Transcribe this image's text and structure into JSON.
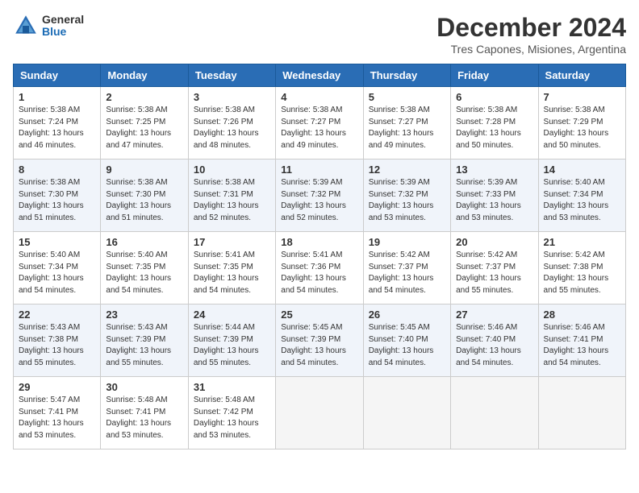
{
  "header": {
    "logo_general": "General",
    "logo_blue": "Blue",
    "month_title": "December 2024",
    "subtitle": "Tres Capones, Misiones, Argentina"
  },
  "columns": [
    "Sunday",
    "Monday",
    "Tuesday",
    "Wednesday",
    "Thursday",
    "Friday",
    "Saturday"
  ],
  "weeks": [
    {
      "shaded": false,
      "days": [
        {
          "num": "1",
          "info": "Sunrise: 5:38 AM\nSunset: 7:24 PM\nDaylight: 13 hours\nand 46 minutes."
        },
        {
          "num": "2",
          "info": "Sunrise: 5:38 AM\nSunset: 7:25 PM\nDaylight: 13 hours\nand 47 minutes."
        },
        {
          "num": "3",
          "info": "Sunrise: 5:38 AM\nSunset: 7:26 PM\nDaylight: 13 hours\nand 48 minutes."
        },
        {
          "num": "4",
          "info": "Sunrise: 5:38 AM\nSunset: 7:27 PM\nDaylight: 13 hours\nand 49 minutes."
        },
        {
          "num": "5",
          "info": "Sunrise: 5:38 AM\nSunset: 7:27 PM\nDaylight: 13 hours\nand 49 minutes."
        },
        {
          "num": "6",
          "info": "Sunrise: 5:38 AM\nSunset: 7:28 PM\nDaylight: 13 hours\nand 50 minutes."
        },
        {
          "num": "7",
          "info": "Sunrise: 5:38 AM\nSunset: 7:29 PM\nDaylight: 13 hours\nand 50 minutes."
        }
      ]
    },
    {
      "shaded": true,
      "days": [
        {
          "num": "8",
          "info": "Sunrise: 5:38 AM\nSunset: 7:30 PM\nDaylight: 13 hours\nand 51 minutes."
        },
        {
          "num": "9",
          "info": "Sunrise: 5:38 AM\nSunset: 7:30 PM\nDaylight: 13 hours\nand 51 minutes."
        },
        {
          "num": "10",
          "info": "Sunrise: 5:38 AM\nSunset: 7:31 PM\nDaylight: 13 hours\nand 52 minutes."
        },
        {
          "num": "11",
          "info": "Sunrise: 5:39 AM\nSunset: 7:32 PM\nDaylight: 13 hours\nand 52 minutes."
        },
        {
          "num": "12",
          "info": "Sunrise: 5:39 AM\nSunset: 7:32 PM\nDaylight: 13 hours\nand 53 minutes."
        },
        {
          "num": "13",
          "info": "Sunrise: 5:39 AM\nSunset: 7:33 PM\nDaylight: 13 hours\nand 53 minutes."
        },
        {
          "num": "14",
          "info": "Sunrise: 5:40 AM\nSunset: 7:34 PM\nDaylight: 13 hours\nand 53 minutes."
        }
      ]
    },
    {
      "shaded": false,
      "days": [
        {
          "num": "15",
          "info": "Sunrise: 5:40 AM\nSunset: 7:34 PM\nDaylight: 13 hours\nand 54 minutes."
        },
        {
          "num": "16",
          "info": "Sunrise: 5:40 AM\nSunset: 7:35 PM\nDaylight: 13 hours\nand 54 minutes."
        },
        {
          "num": "17",
          "info": "Sunrise: 5:41 AM\nSunset: 7:35 PM\nDaylight: 13 hours\nand 54 minutes."
        },
        {
          "num": "18",
          "info": "Sunrise: 5:41 AM\nSunset: 7:36 PM\nDaylight: 13 hours\nand 54 minutes."
        },
        {
          "num": "19",
          "info": "Sunrise: 5:42 AM\nSunset: 7:37 PM\nDaylight: 13 hours\nand 54 minutes."
        },
        {
          "num": "20",
          "info": "Sunrise: 5:42 AM\nSunset: 7:37 PM\nDaylight: 13 hours\nand 55 minutes."
        },
        {
          "num": "21",
          "info": "Sunrise: 5:42 AM\nSunset: 7:38 PM\nDaylight: 13 hours\nand 55 minutes."
        }
      ]
    },
    {
      "shaded": true,
      "days": [
        {
          "num": "22",
          "info": "Sunrise: 5:43 AM\nSunset: 7:38 PM\nDaylight: 13 hours\nand 55 minutes."
        },
        {
          "num": "23",
          "info": "Sunrise: 5:43 AM\nSunset: 7:39 PM\nDaylight: 13 hours\nand 55 minutes."
        },
        {
          "num": "24",
          "info": "Sunrise: 5:44 AM\nSunset: 7:39 PM\nDaylight: 13 hours\nand 55 minutes."
        },
        {
          "num": "25",
          "info": "Sunrise: 5:45 AM\nSunset: 7:39 PM\nDaylight: 13 hours\nand 54 minutes."
        },
        {
          "num": "26",
          "info": "Sunrise: 5:45 AM\nSunset: 7:40 PM\nDaylight: 13 hours\nand 54 minutes."
        },
        {
          "num": "27",
          "info": "Sunrise: 5:46 AM\nSunset: 7:40 PM\nDaylight: 13 hours\nand 54 minutes."
        },
        {
          "num": "28",
          "info": "Sunrise: 5:46 AM\nSunset: 7:41 PM\nDaylight: 13 hours\nand 54 minutes."
        }
      ]
    },
    {
      "shaded": false,
      "days": [
        {
          "num": "29",
          "info": "Sunrise: 5:47 AM\nSunset: 7:41 PM\nDaylight: 13 hours\nand 53 minutes."
        },
        {
          "num": "30",
          "info": "Sunrise: 5:48 AM\nSunset: 7:41 PM\nDaylight: 13 hours\nand 53 minutes."
        },
        {
          "num": "31",
          "info": "Sunrise: 5:48 AM\nSunset: 7:42 PM\nDaylight: 13 hours\nand 53 minutes."
        },
        {
          "num": "",
          "info": ""
        },
        {
          "num": "",
          "info": ""
        },
        {
          "num": "",
          "info": ""
        },
        {
          "num": "",
          "info": ""
        }
      ]
    }
  ]
}
